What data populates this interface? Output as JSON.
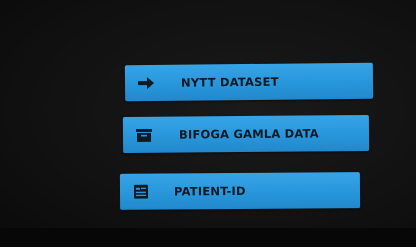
{
  "menu": {
    "items": [
      {
        "label": "NYTT DATASET",
        "icon": "arrow-right-icon"
      },
      {
        "label": "BIFOGA GAMLA DATA",
        "icon": "archive-box-icon"
      },
      {
        "label": "PATIENT-ID",
        "icon": "id-card-icon"
      }
    ],
    "button_color": "#2896db",
    "text_color": "#0d1a24"
  }
}
